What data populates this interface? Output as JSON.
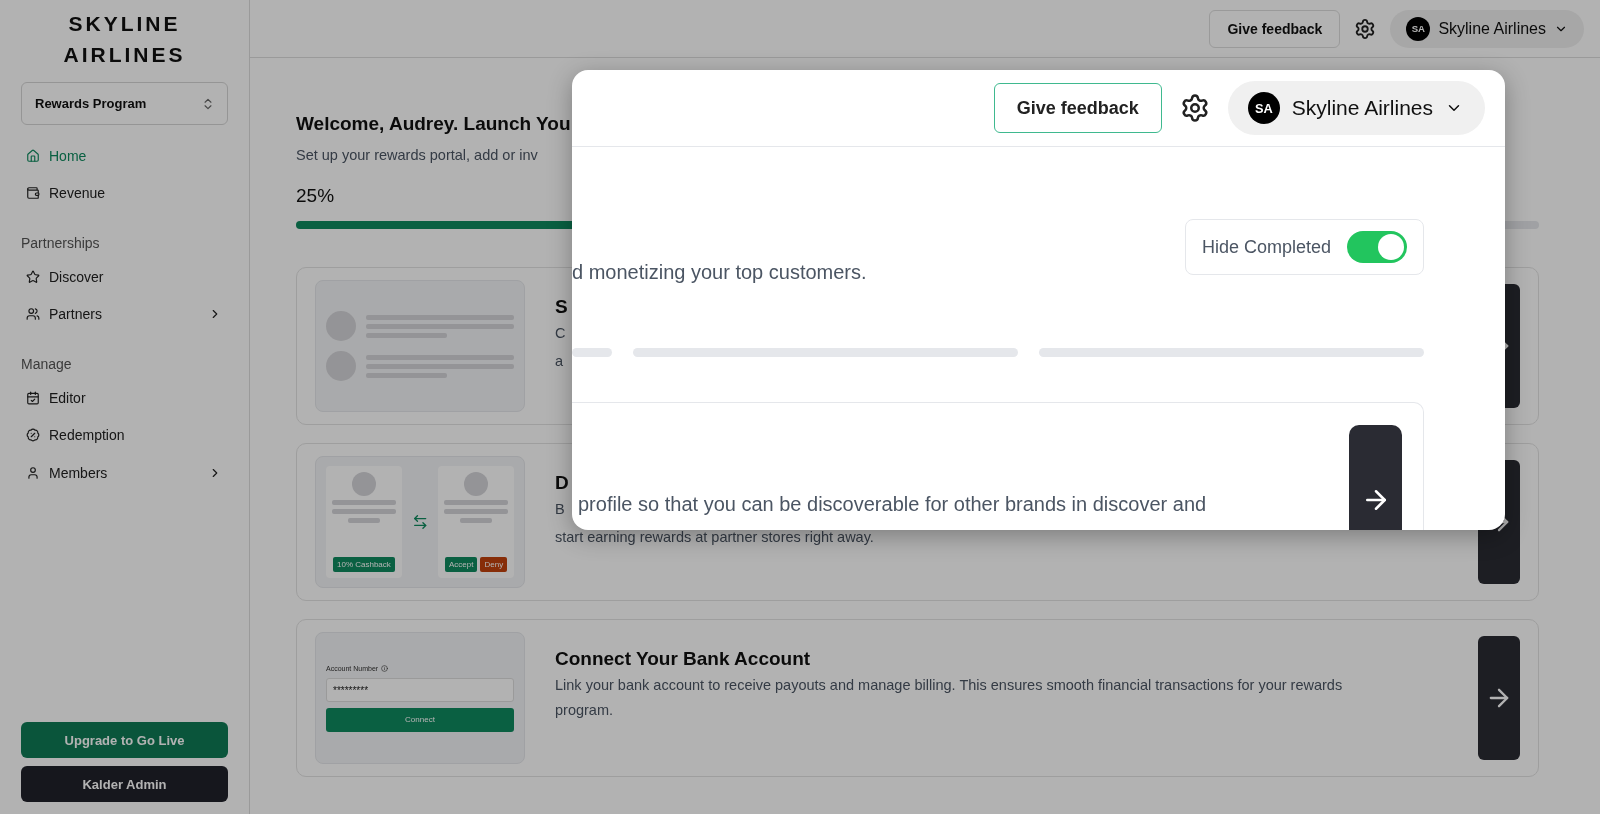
{
  "sidebar": {
    "brand_lines": [
      "SKYLINE",
      "AIRLINES"
    ],
    "program_select": {
      "value": "Rewards Program"
    },
    "groups": [
      {
        "items": [
          {
            "label": "Home",
            "selected": true,
            "expandable": false
          },
          {
            "label": "Revenue",
            "selected": false,
            "expandable": false
          }
        ]
      },
      {
        "heading": "Partnerships",
        "items": [
          {
            "label": "Discover",
            "selected": false,
            "expandable": false
          },
          {
            "label": "Partners",
            "selected": false,
            "expandable": true
          }
        ]
      },
      {
        "heading": "Manage",
        "items": [
          {
            "label": "Editor",
            "selected": false,
            "expandable": false
          },
          {
            "label": "Redemption",
            "selected": false,
            "expandable": false
          },
          {
            "label": "Members",
            "selected": false,
            "expandable": true
          }
        ]
      }
    ],
    "buttons": [
      {
        "label": "Upgrade to Go Live",
        "kind": "primary"
      },
      {
        "label": "Kalder Admin",
        "kind": "dark"
      }
    ]
  },
  "header": {
    "feedback_button": "Give feedback",
    "account": {
      "initials": "SA",
      "name": "Skyline Airlines"
    }
  },
  "welcome": {
    "title": "Welcome, Audrey. Launch You",
    "subtitle": "Set up your rewards portal, add or inv",
    "progress": {
      "label": "25%",
      "level": 0.25
    }
  },
  "cards": [
    {
      "kind": "profiles",
      "title": "S",
      "description_lines": [
        "C",
        "a"
      ]
    },
    {
      "kind": "exchange",
      "title": "D",
      "description_lines": [
        "B",
        "start earning rewards at partner stores right away."
      ],
      "illustration": {
        "cashback": "10% Cashback",
        "accept": "Accept",
        "deny": "Deny"
      }
    },
    {
      "kind": "bank",
      "title": "Connect Your Bank Account",
      "description_lines": [
        "Link your bank account to receive payouts and manage billing. This ensures smooth financial transactions for your rewards program."
      ],
      "illustration": {
        "field_label": "Account Number",
        "field_value": "*********",
        "button": "Connect"
      }
    }
  ],
  "magnifier": {
    "feedback_button": "Give feedback",
    "account": {
      "initials": "SA",
      "name": "Skyline Airlines"
    },
    "hide_completed": {
      "label": "Hide Completed",
      "on": true
    },
    "subtitle_fragment": "d monetizing your top customers.",
    "step_text_fragment": "profile so that you can be discoverable for other brands in discover and"
  }
}
